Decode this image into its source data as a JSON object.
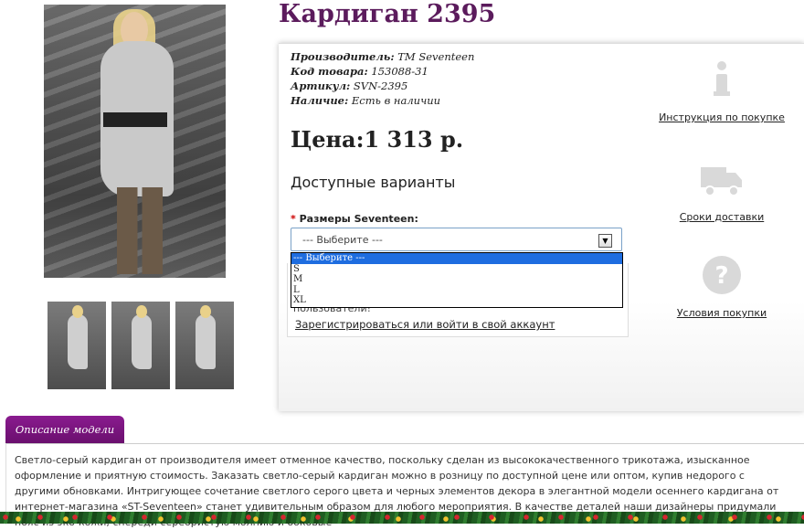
{
  "product": {
    "title": "Кардиган 2395",
    "info": [
      {
        "label": "Производитель:",
        "value": "TM Seventeen"
      },
      {
        "label": "Код товара:",
        "value": "153088-31"
      },
      {
        "label": "Артикул:",
        "value": "SVN-2395"
      },
      {
        "label": "Наличие:",
        "value": "Есть в наличии"
      }
    ],
    "price": "Цена:1 313 р.",
    "variants_title": "Доступные варианты",
    "size_required_mark": "*",
    "size_label": "Размеры Seventeen:",
    "size_select_value": "--- Выберите ---",
    "size_options": [
      "--- Выберите ---",
      "S",
      "M",
      "L",
      "XL"
    ],
    "hint_text": "пользователи!",
    "register_link": "Зарегистрироваться или войти в свой аккаунт"
  },
  "side_links": {
    "instructions": "Инструкция по покупке",
    "delivery": "Сроки доставки",
    "terms": "Условия покупки"
  },
  "description": {
    "tab_label": "Описание модели",
    "text": "Светло-серый кардиган от производителя имеет отменное качество, поскольку сделан из высококачественного трикотажа, изысканное оформление и приятную стоимость. Заказать светло-серый кардиган можно в розницу по доступной цене или оптом, купив недорого с другими обновками. Интригующее сочетание светлого серого цвета и черных элементов декора в элегантной модели осеннего кардигана от интернет-магазина «ST-Seventeen» станет удивительным образом для любого мероприятия. В качестве деталей наши дизайнеры придумали пояс из эко-кожи, спереди серебристую молнию и боковые"
  },
  "icons": {
    "info": "info-icon",
    "truck": "truck-icon",
    "question": "question-icon"
  },
  "colors": {
    "title": "#5b1b5c",
    "tab": "#7a157e",
    "selected_option": "#1e6de0"
  }
}
